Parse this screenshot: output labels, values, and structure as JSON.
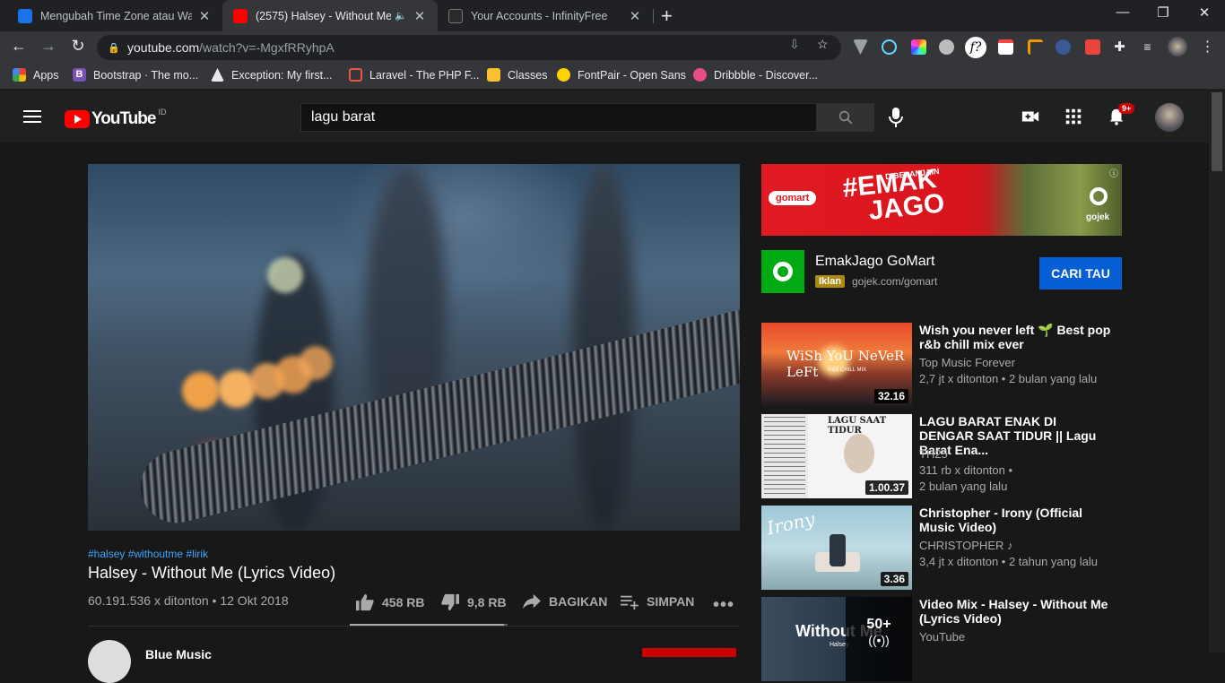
{
  "browser": {
    "tabs": [
      {
        "title": "Mengubah Time Zone atau Wakt",
        "active": false
      },
      {
        "title": "(2575) Halsey - Without Me (",
        "active": true
      },
      {
        "title": "Your Accounts - InfinityFree",
        "active": false
      }
    ],
    "url_host": "youtube.com",
    "url_path": "/watch?v=-MgxfRRyhpA",
    "bookmarks": [
      "Apps",
      "Bootstrap · The mo...",
      "Exception: My first...",
      "Laravel - The PHP F...",
      "Classes",
      "FontPair - Open Sans",
      "Dribbble - Discover..."
    ]
  },
  "youtube": {
    "logo_text": "YouTube",
    "country_code": "ID",
    "search_value": "lagu barat",
    "notification_count": "9+"
  },
  "video": {
    "hashtags": "#halsey #withoutme #lirik",
    "title": "Halsey - Without Me (Lyrics Video)",
    "views_date": "60.191.536 x ditonton • 12 Okt 2018",
    "likes": "458 RB",
    "dislikes": "9,8 RB",
    "share_label": "BAGIKAN",
    "save_label": "SIMPAN",
    "like_ratio": 0.979,
    "channel_name": "Blue Music"
  },
  "ad": {
    "banner_top": "DIBELANJAIN",
    "banner_main_1": "#EMAK",
    "banner_main_2": "JAGO",
    "banner_brand": "gomart",
    "banner_partner": "gojek",
    "title": "EmakJago GoMart",
    "tag": "Iklan",
    "domain": "gojek.com/gomart",
    "cta": "CARI TAU"
  },
  "recommendations": [
    {
      "title": "Wish you never left 🌱 Best pop r&b chill mix ever",
      "channel": "Top Music Forever",
      "meta1": "2,7 jt x ditonton • 2 bulan yang lalu",
      "meta2": "",
      "duration": "32.16",
      "thumb_text": "WiSh YoU NeVeR LeFt",
      "thumb_sub": "R&B CHILL MIX"
    },
    {
      "title": "LAGU BARAT ENAK DI DENGAR SAAT TIDUR || Lagu Barat Ena...",
      "channel": "TH25",
      "meta1": "311 rb x ditonton •",
      "meta2": "2 bulan yang lalu",
      "duration": "1.00.37",
      "thumb_text": "LAGU SAAT TIDUR",
      "thumb_sub": ""
    },
    {
      "title": "Christopher - Irony (Official Music Video)",
      "channel": "CHRISTOPHER ♪",
      "meta1": "3,4 jt x ditonton • 2 tahun yang lalu",
      "meta2": "",
      "duration": "3.36",
      "thumb_text": "Irony",
      "thumb_sub": ""
    },
    {
      "title": "Video Mix - Halsey - Without Me (Lyrics Video)",
      "channel": "YouTube",
      "meta1": "",
      "meta2": "",
      "duration": "50+",
      "thumb_text": "Without Me",
      "thumb_sub": "Halsey"
    }
  ]
}
